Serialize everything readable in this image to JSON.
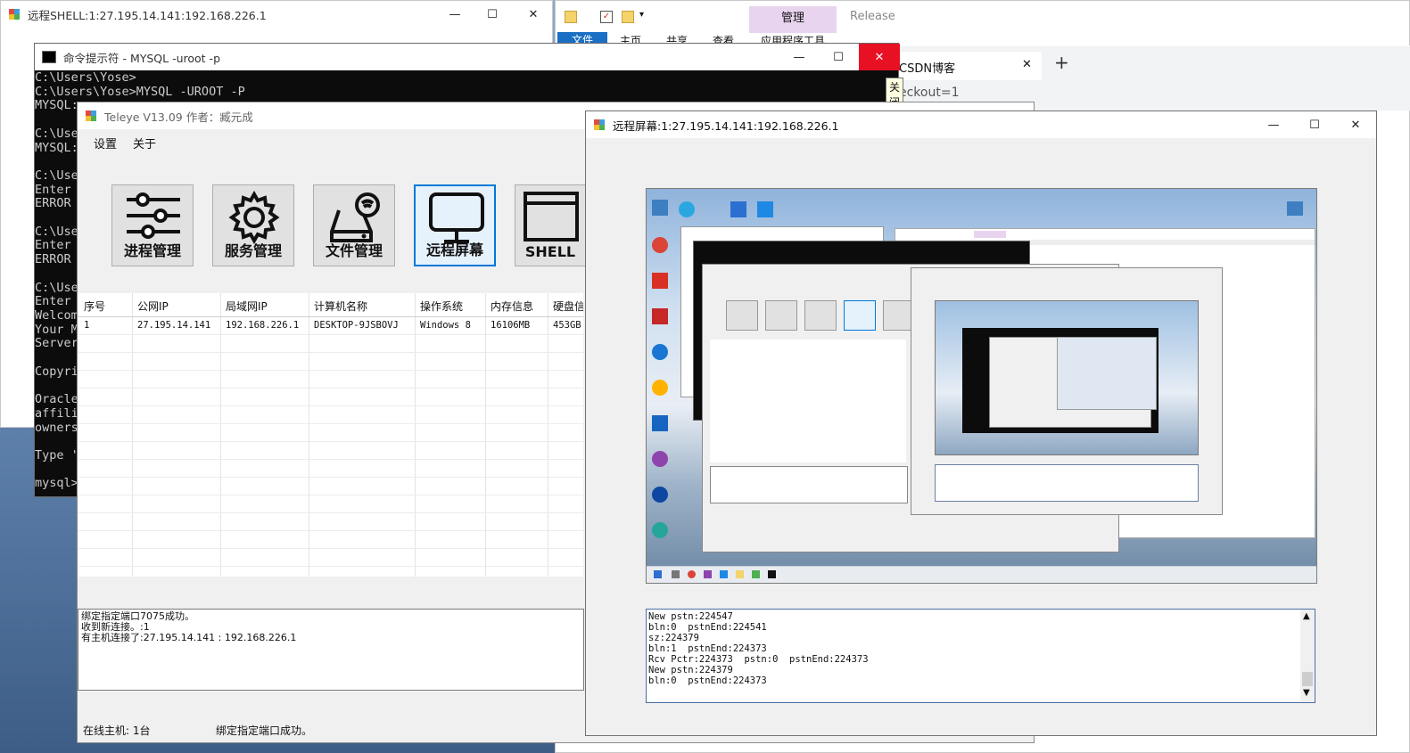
{
  "shell_window": {
    "title": "远程SHELL:1:27.195.14.141:192.168.226.1"
  },
  "explorer_window": {
    "tab_manage": "管理",
    "tab_release": "Release",
    "ribbon_tabs": [
      "文件",
      "主页",
      "共享",
      "查看",
      "应用程序工具"
    ]
  },
  "browser_window": {
    "tab_title": "CSDN博客",
    "url_fragment": "eckout=1",
    "new_tab": "+"
  },
  "cmd_window": {
    "title": "命令提示符 - MYSQL  -uroot -p",
    "close_tooltip": "关闭",
    "lines": [
      "C:\\Users\\Yose>",
      "C:\\Users\\Yose>MYSQL -UROOT -P",
      "MYSQL:",
      "",
      "C:\\Use",
      "MYSQL:",
      "",
      "C:\\Use",
      "Enter",
      "ERROR",
      "",
      "C:\\Use",
      "Enter",
      "ERROR",
      "",
      "C:\\Use",
      "Enter",
      "Welcom",
      "Your M",
      "Server",
      "",
      "Copyri",
      "",
      "Oracle",
      "affili",
      "owners",
      "",
      "Type '",
      "",
      "mysql>"
    ]
  },
  "teleye_window": {
    "title": "Teleye V13.09 作者：臧元成",
    "menu": [
      "设置",
      "关于"
    ],
    "tools": [
      "进程管理",
      "服务管理",
      "文件管理",
      "远程屏幕",
      "SHELL"
    ],
    "table": {
      "headers": [
        "序号",
        "公网IP",
        "局域网IP",
        "计算机名称",
        "操作系统",
        "内存信息",
        "硬盘信"
      ],
      "rows": [
        [
          "1",
          "27.195.14.141",
          "192.168.226.1",
          "DESKTOP-9JSBOVJ",
          "Windows 8",
          "16106MB",
          "453GB"
        ]
      ]
    },
    "log": [
      "绑定指定端口7075成功。",
      "收到新连接。:1",
      "有主机连接了:27.195.14.141 : 192.168.226.1"
    ],
    "status_left": "在线主机: 1台",
    "status_right": "绑定指定端口成功。"
  },
  "remote_window": {
    "title": "远程屏幕:1:27.195.14.141:192.168.226.1",
    "log": [
      "New pstn:224547",
      "bln:0  pstnEnd:224541",
      "sz:224379",
      "bln:1  pstnEnd:224373",
      "Rcv Pctr:224373  pstn:0  pstnEnd:224373",
      "New pstn:224379",
      "bln:0  pstnEnd:224373",
      ""
    ]
  }
}
